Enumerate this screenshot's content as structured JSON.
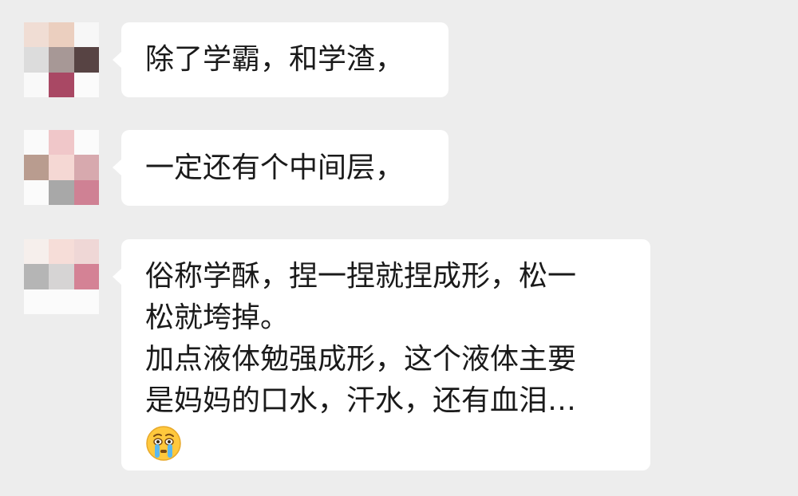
{
  "chat": {
    "messages": [
      {
        "sender": "left",
        "text": "除了学霸，和学渣，",
        "avatar_colors": [
          "#f0ddd4",
          "#ebcfbf",
          "#f7f7f7",
          "#dcdcdc",
          "#a79896",
          "#574343",
          "#f9f9f9",
          "#a94864",
          "#fbfbfb"
        ]
      },
      {
        "sender": "left",
        "text": "一定还有个中间层，",
        "avatar_colors": [
          "#fafafa",
          "#f0c7c9",
          "#fbfbfb",
          "#b99c8f",
          "#f5d8d4",
          "#d7a9ae",
          "#fbfbfb",
          "#a8a8a8",
          "#cf8194"
        ]
      },
      {
        "sender": "left",
        "text": "俗称学酥，捏一捏就捏成形，松一\n松就垮掉。\n加点液体勉强成形，这个液体主要\n是妈妈的口水，汗水，还有血泪…",
        "emoji": "crying-face-emoji",
        "avatar_colors": [
          "#f6efec",
          "#f6ddd8",
          "#efd7d6",
          "#b5b5b5",
          "#d6d4d4",
          "#d48295",
          "#fbfbfb",
          "#fbfbfb",
          "#fbfbfb"
        ]
      }
    ]
  },
  "colors": {
    "background": "#ededed",
    "bubble": "#ffffff",
    "text": "#1a1a1a",
    "emoji_face": "#ffc83d"
  }
}
